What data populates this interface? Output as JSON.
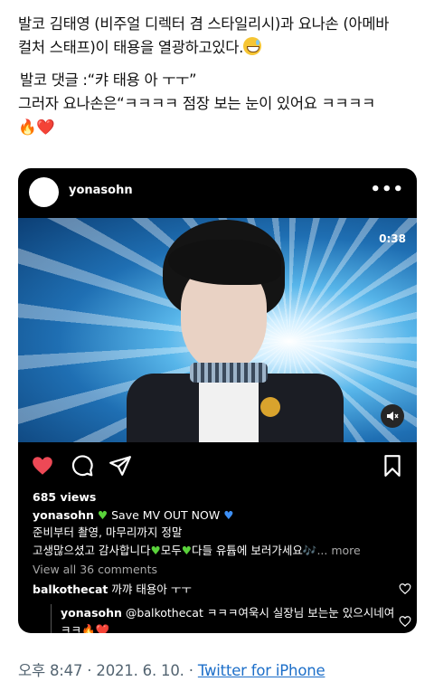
{
  "tweet": {
    "line1": "발코 김태영 (비주얼 디렉터 겸 스타일리시)과 요나손 (아메바",
    "line2": "컬처 스태프)이 태용을 열광하고있다.",
    "line3": "발코 댓글 :“캬 태용 아 ㅜㅜ”",
    "line4": "그러자 요나손은“ㅋㅋㅋㅋ 점장 보는 눈이 있어요 ㅋㅋㅋㅋ",
    "line5_emojis": "🔥❤️"
  },
  "instagram": {
    "username": "yonasohn",
    "video_time": "0:38",
    "views": "685 views",
    "caption_user": "yonasohn",
    "caption_line1": "Save MV OUT NOW",
    "caption_line2": "준비부터 촬영, 마무리까지 정말",
    "caption_line3_a": "고생많으셨고 감사합니다",
    "caption_line3_b": "모두",
    "caption_line3_c": "다들 유튭에 보러가세요🎶",
    "more": "... more",
    "view_comments": "View all 36 comments",
    "comment1_user": "balkothecat",
    "comment1_text": "까꺄 태용아 ㅜㅜ",
    "comment2_user": "yonasohn",
    "comment2_text": "@balkothecat ㅋㅋㅋ여욱시 실장님 보는눈 있으시네여",
    "comment2_text2": "ㅋㅋ🔥❤️"
  },
  "footer": {
    "time": "오후 8:47 · 2021. 6. 10. · ",
    "source": "Twitter for iPhone"
  },
  "colors": {
    "link": "#1d6fc9",
    "like_red": "#ed4956",
    "heart_green": "#5ad23b",
    "heart_blue": "#3d8ff5"
  },
  "icons": [
    "grinning-sweat-emoji",
    "fire-emoji",
    "red-heart-emoji",
    "more-dots-icon",
    "mute-icon",
    "heart-icon",
    "comment-icon",
    "share-icon",
    "bookmark-icon"
  ]
}
